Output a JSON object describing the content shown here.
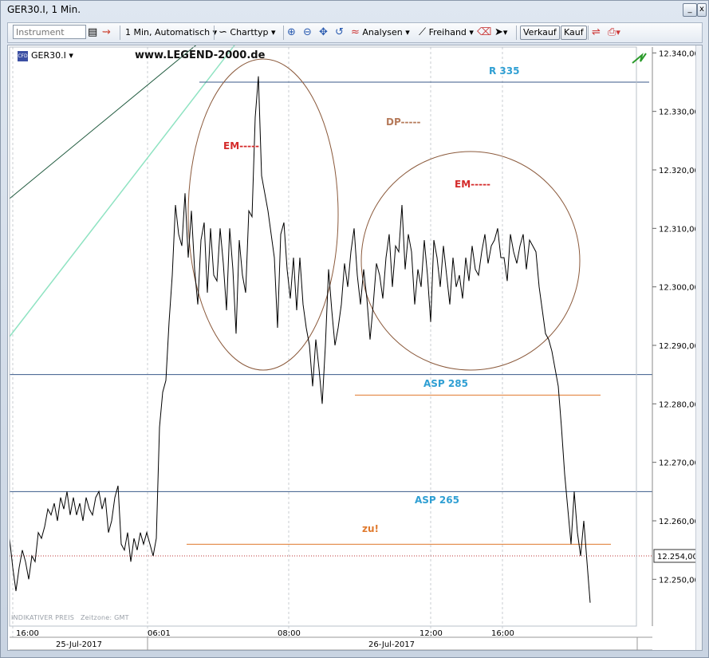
{
  "window": {
    "title": "GER30.I, 1 Min."
  },
  "toolbar": {
    "instrument_placeholder": "Instrument",
    "interval_label": "1 Min,",
    "scale_label": "Automatisch",
    "charttype_label": "Charttyp",
    "analysen_label": "Analysen",
    "freihand_label": "Freihand",
    "verkauf_label": "Verkauf",
    "kauf_label": "Kauf"
  },
  "chart": {
    "instrument": "GER30.I",
    "logo_text": "CFD",
    "watermark": "www.LEGEND-2000.de",
    "footnote_price": "INDIKATIVER PREIS",
    "footnote_timezone": "Zeitzone: GMT",
    "current_price_label": "12.254,00",
    "colors": {
      "price": "#000000",
      "level": "#3a5a8a",
      "ellipse": "#8b5a3c",
      "support": "#e07a2e",
      "label_blue": "#2f9fd3",
      "label_red": "#d42a2a",
      "label_brown": "#b57a5a",
      "trend_dark": "#1f5a3e",
      "trend_light": "#8fe3c2"
    }
  },
  "chart_data": {
    "type": "line",
    "title": "",
    "ylim": [
      12242,
      12341
    ],
    "y_ticks": [
      "12.250,00",
      "12.260,00",
      "12.270,00",
      "12.280,00",
      "12.290,00",
      "12.300,00",
      "12.310,00",
      "12.320,00",
      "12.330,00",
      "12.340,00"
    ],
    "x_ticks": [
      "16:00",
      "06:01",
      "08:00",
      "12:00",
      "16:00"
    ],
    "date_labels": [
      "25-Jul-2017",
      "26-Jul-2017"
    ],
    "series": [
      {
        "x_index": [
          0,
          4,
          8,
          12,
          16,
          20,
          24,
          28,
          32,
          36,
          40,
          44,
          48,
          52,
          56,
          60,
          64,
          68,
          72,
          76,
          80,
          84,
          88,
          92,
          96,
          100,
          104,
          108,
          112,
          116,
          120,
          124,
          128,
          132,
          136,
          140,
          144,
          148,
          152,
          156,
          160,
          164,
          168,
          172,
          176,
          180,
          184,
          188,
          192,
          196,
          200,
          204,
          208,
          212,
          216,
          220,
          224,
          228,
          232,
          236,
          240,
          244,
          248,
          252,
          256,
          260,
          264,
          268,
          272,
          276,
          280,
          284,
          288,
          292,
          296,
          300,
          304,
          308,
          312,
          316,
          320,
          324,
          328,
          332,
          336,
          340,
          344,
          348,
          352,
          356,
          360,
          364,
          368,
          372,
          376,
          380,
          384,
          388,
          392,
          396,
          400,
          404,
          408,
          412,
          416,
          420,
          424,
          428,
          432,
          436,
          440,
          444,
          448,
          452,
          456,
          460,
          464,
          468,
          472,
          476,
          480,
          484,
          488,
          492,
          496,
          500,
          504,
          508,
          512,
          516,
          520,
          524,
          528,
          532,
          536,
          540,
          544,
          548,
          552,
          556,
          560,
          564,
          568,
          572,
          576,
          580,
          584,
          588,
          592,
          596,
          600,
          604,
          608,
          612,
          616,
          620,
          624,
          628,
          632,
          636,
          640,
          644,
          648,
          652,
          656,
          660,
          664,
          668,
          672,
          676,
          680,
          684,
          688,
          692,
          696,
          700,
          704,
          708,
          712,
          716,
          720,
          724,
          728,
          732,
          736,
          740,
          744,
          748,
          752,
          756,
          760,
          764,
          768,
          772,
          776,
          780,
          784
        ],
        "values": [
          12257,
          12252,
          12248,
          12252,
          12255,
          12253,
          12250,
          12254,
          12253,
          12258,
          12257,
          12259,
          12262,
          12261,
          12263,
          12260,
          12264,
          12262,
          12265,
          12261,
          12264,
          12261,
          12263,
          12260,
          12264,
          12262,
          12261,
          12264,
          12265,
          12262,
          12264,
          12258,
          12260,
          12264,
          12266,
          12256,
          12255,
          12258,
          12253,
          12257,
          12255,
          12258,
          12256,
          12258,
          12256,
          12254,
          12257,
          12276,
          12282,
          12284,
          12294,
          12302,
          12314,
          12309,
          12307,
          12316,
          12305,
          12313,
          12303,
          12297,
          12308,
          12311,
          12299,
          12310,
          12302,
          12301,
          12310,
          12304,
          12296,
          12310,
          12303,
          12292,
          12308,
          12302,
          12299,
          12313,
          12312,
          12329,
          12336,
          12319,
          12316,
          12313,
          12309,
          12305,
          12293,
          12309,
          12311,
          12303,
          12298,
          12305,
          12296,
          12305,
          12297,
          12293,
          12290,
          12283,
          12291,
          12286,
          12280,
          12290,
          12303,
          12296,
          12290,
          12293,
          12297,
          12304,
          12300,
          12306,
          12310,
          12302,
          12297,
          12303,
          12298,
          12291,
          12297,
          12304,
          12302,
          12298,
          12305,
          12309,
          12300,
          12307,
          12306,
          12314,
          12303,
          12309,
          12306,
          12297,
          12303,
          12300,
          12308,
          12302,
          12294,
          12308,
          12305,
          12300,
          12307,
          12302,
          12297,
          12305,
          12300,
          12302,
          12298,
          12305,
          12301,
          12307,
          12303,
          12302,
          12306,
          12309,
          12304,
          12307,
          12308,
          12310,
          12305,
          12305,
          12301,
          12309,
          12306,
          12304,
          12307,
          12309,
          12303,
          12308,
          12307,
          12306,
          12300,
          12296,
          12292,
          12291,
          12289,
          12286,
          12283,
          12276,
          12268,
          12262,
          12256,
          12265,
          12258,
          12254,
          12260,
          12253,
          12246
        ]
      }
    ],
    "levels": [
      {
        "name": "R 335",
        "value": 12335
      },
      {
        "name": "ASP 285",
        "value": 12285
      },
      {
        "name": "ASP 265",
        "value": 12265
      },
      {
        "name": "current",
        "value": 12254
      }
    ],
    "annotations": [
      "R 335",
      "DP-----",
      "EM-----",
      "EM-----",
      "ASP 285",
      "ASP 265",
      "zu!"
    ]
  }
}
